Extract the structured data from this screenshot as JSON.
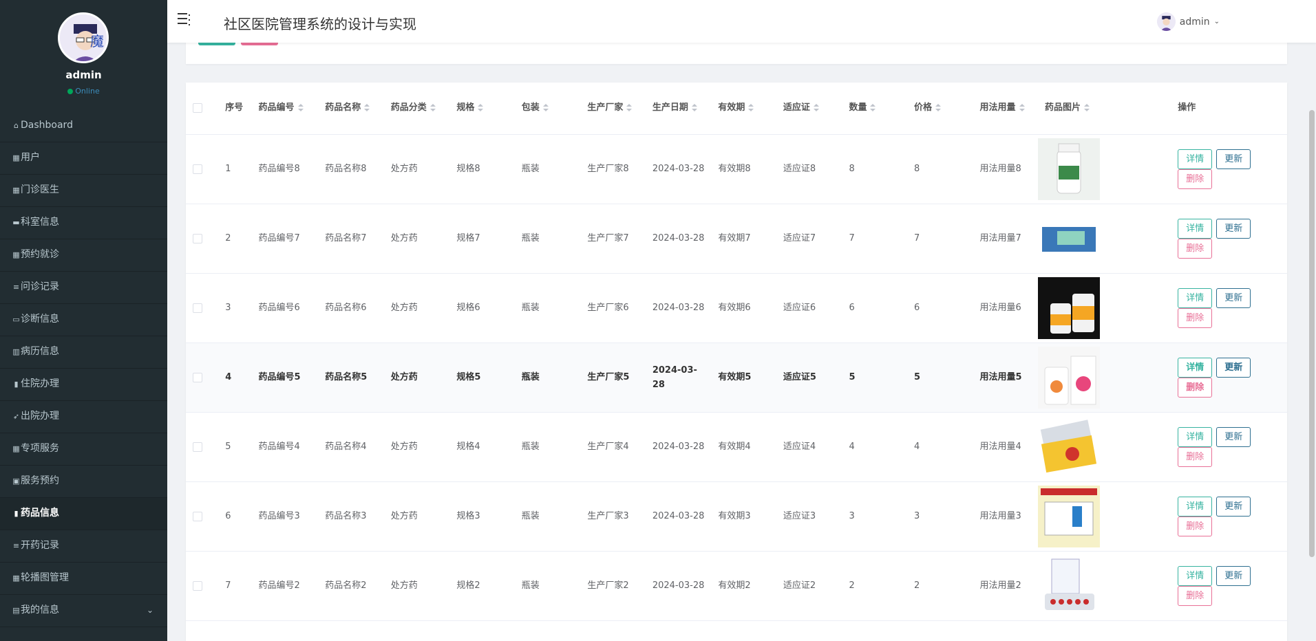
{
  "app": {
    "title": "社区医院管理系统的设计与实现"
  },
  "user": {
    "name": "admin",
    "status": "Online"
  },
  "topuser": {
    "name": "admin"
  },
  "menu": [
    {
      "label": "Dashboard",
      "icon": "home-icon"
    },
    {
      "label": "用户",
      "icon": "grid-icon"
    },
    {
      "label": "门诊医生",
      "icon": "grid-icon"
    },
    {
      "label": "科室信息",
      "icon": "comment-icon"
    },
    {
      "label": "预约就诊",
      "icon": "grid-icon"
    },
    {
      "label": "问诊记录",
      "icon": "list-icon"
    },
    {
      "label": "诊断信息",
      "icon": "card-icon"
    },
    {
      "label": "病历信息",
      "icon": "bar-chart-icon"
    },
    {
      "label": "住院办理",
      "icon": "pill-icon"
    },
    {
      "label": "出院办理",
      "icon": "send-icon"
    },
    {
      "label": "专项服务",
      "icon": "grid-icon"
    },
    {
      "label": "服务预约",
      "icon": "clipboard-icon"
    },
    {
      "label": "药品信息",
      "icon": "pill-icon",
      "active": true
    },
    {
      "label": "开药记录",
      "icon": "list-icon"
    },
    {
      "label": "轮播图管理",
      "icon": "grid-icon"
    },
    {
      "label": "我的信息",
      "icon": "id-card-icon",
      "expandable": true
    }
  ],
  "table": {
    "columns": [
      "序号",
      "药品编号",
      "药品名称",
      "药品分类",
      "规格",
      "包装",
      "生产厂家",
      "生产日期",
      "有效期",
      "适应证",
      "数量",
      "价格",
      "用法用量",
      "药品图片",
      "操作"
    ],
    "actions": {
      "detail": "详情",
      "update": "更新",
      "delete": "删除"
    },
    "rows": [
      {
        "no": "1",
        "code": "药品编号8",
        "name": "药品名称8",
        "cat": "处方药",
        "spec": "规格8",
        "pack": "瓶装",
        "maker": "生产厂家8",
        "date": "2024-03-28",
        "valid": "有效期8",
        "ind": "适应证8",
        "qty": "8",
        "price": "8",
        "usage": "用法用量8"
      },
      {
        "no": "2",
        "code": "药品编号7",
        "name": "药品名称7",
        "cat": "处方药",
        "spec": "规格7",
        "pack": "瓶装",
        "maker": "生产厂家7",
        "date": "2024-03-28",
        "valid": "有效期7",
        "ind": "适应证7",
        "qty": "7",
        "price": "7",
        "usage": "用法用量7"
      },
      {
        "no": "3",
        "code": "药品编号6",
        "name": "药品名称6",
        "cat": "处方药",
        "spec": "规格6",
        "pack": "瓶装",
        "maker": "生产厂家6",
        "date": "2024-03-28",
        "valid": "有效期6",
        "ind": "适应证6",
        "qty": "6",
        "price": "6",
        "usage": "用法用量6"
      },
      {
        "no": "4",
        "code": "药品编号5",
        "name": "药品名称5",
        "cat": "处方药",
        "spec": "规格5",
        "pack": "瓶装",
        "maker": "生产厂家5",
        "date": "2024-03-28",
        "valid": "有效期5",
        "ind": "适应证5",
        "qty": "5",
        "price": "5",
        "usage": "用法用量5"
      },
      {
        "no": "5",
        "code": "药品编号4",
        "name": "药品名称4",
        "cat": "处方药",
        "spec": "规格4",
        "pack": "瓶装",
        "maker": "生产厂家4",
        "date": "2024-03-28",
        "valid": "有效期4",
        "ind": "适应证4",
        "qty": "4",
        "price": "4",
        "usage": "用法用量4"
      },
      {
        "no": "6",
        "code": "药品编号3",
        "name": "药品名称3",
        "cat": "处方药",
        "spec": "规格3",
        "pack": "瓶装",
        "maker": "生产厂家3",
        "date": "2024-03-28",
        "valid": "有效期3",
        "ind": "适应证3",
        "qty": "3",
        "price": "3",
        "usage": "用法用量3"
      },
      {
        "no": "7",
        "code": "药品编号2",
        "name": "药品名称2",
        "cat": "处方药",
        "spec": "规格2",
        "pack": "瓶装",
        "maker": "生产厂家2",
        "date": "2024-03-28",
        "valid": "有效期2",
        "ind": "适应证2",
        "qty": "2",
        "price": "2",
        "usage": "用法用量2"
      }
    ]
  },
  "colors": {
    "sidebar": "#222d32",
    "detail": "#36b3a0",
    "update": "#2c6e8f",
    "delete": "#e86f96"
  }
}
